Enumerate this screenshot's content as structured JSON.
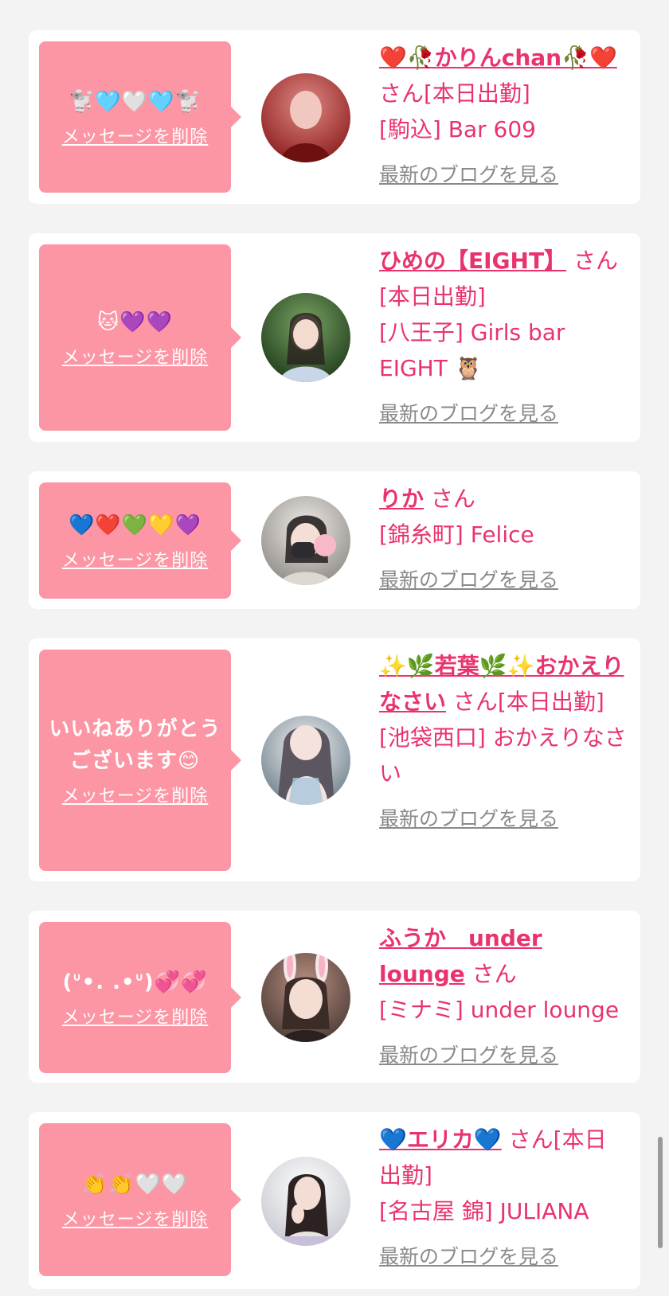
{
  "delete_label": "メッセージを削除",
  "blog_label": "最新のブログを見る",
  "san_label": "さん",
  "cards": [
    {
      "message": "🐩🩵🤍🩵🐩",
      "name": "❤️🥀かりんchan🥀❤️",
      "suffix": "さん[本日出勤]",
      "shop": "[駒込] Bar 609",
      "avatar_colors": [
        "#c0332c",
        "#8a1b1b"
      ]
    },
    {
      "message": "🐱💜💜",
      "name": "ひめの【EIGHT】",
      "suffix": "さん[本日出勤]",
      "shop": "[八王子] Girls bar EIGHT 🦉",
      "avatar_colors": [
        "#4c7a3a",
        "#1d3a1a"
      ]
    },
    {
      "message": "💙❤️💚💛💜",
      "name": "りか",
      "suffix": "さん",
      "shop": "[錦糸町] Felice",
      "avatar_colors": [
        "#d9d4cc",
        "#8d8a86"
      ]
    },
    {
      "message": "いいねありがとうございます😊",
      "name": "✨🌿若葉🌿✨おかえりなさい",
      "suffix": "さん[本日出勤]",
      "shop": "[池袋西口] おかえりなさい",
      "avatar_colors": [
        "#cfd8dc",
        "#6e7f8a"
      ]
    },
    {
      "message": "(ᐡ•. .•ᐡ)💞💞",
      "name": "ふうか　under lounge",
      "suffix": "さん",
      "shop": "[ミナミ] under lounge",
      "avatar_colors": [
        "#b89080",
        "#4a3a36"
      ]
    },
    {
      "message": "👏👏🤍🤍",
      "name": "💙エリカ💙",
      "suffix": "さん[本日出勤]",
      "shop": "[名古屋 錦] JULIANA",
      "avatar_colors": [
        "#eceef2",
        "#5a5050"
      ]
    }
  ]
}
